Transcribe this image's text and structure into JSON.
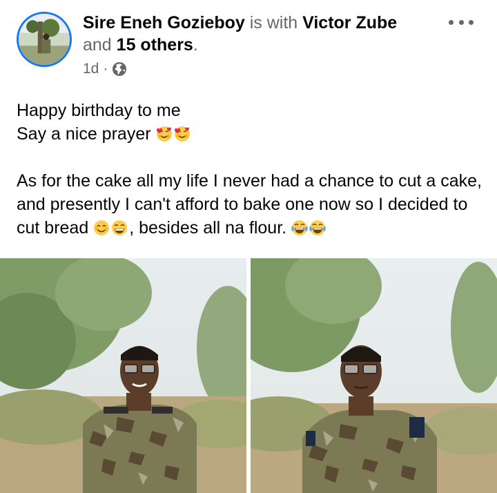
{
  "post": {
    "author": "Sire Eneh Gozieboy",
    "with_text": " is with ",
    "tagged": "Victor Zube",
    "and_text": "and ",
    "others": "15 others",
    "period": ".",
    "time": "1d",
    "dot": "·",
    "privacy_icon": "globe-icon",
    "more_icon": "more-options-icon"
  },
  "body": {
    "line1": "Happy birthday to me",
    "line2": "Say a nice prayer",
    "line2_emojis": [
      "smiling-face-with-hearts",
      "smiling-face-with-hearts"
    ],
    "para_part1": "As for the cake all my life I never had a chance to cut a cake, and presently I can't afford to bake one now so I decided to cut bread ",
    "para_emojis_mid": [
      "smiling-face-with-smiling-eyes",
      "beaming-face-with-smiling-eyes"
    ],
    "para_part2": ", besides all na flour. ",
    "para_emojis_end": [
      "face-with-tears-of-joy",
      "face-with-tears-of-joy"
    ]
  },
  "photos": [
    {
      "name": "photo-soldier-smiling"
    },
    {
      "name": "photo-soldier-closeup"
    }
  ],
  "colors": {
    "avatar_ring": "#1877f2",
    "muted_text": "#65676b",
    "emoji_yellow": "#ffcc4d"
  }
}
